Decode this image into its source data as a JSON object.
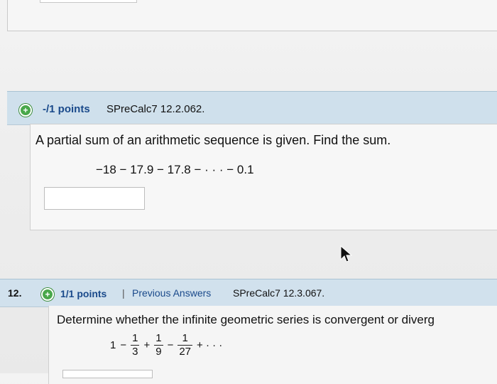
{
  "q11": {
    "points": "-/1 points",
    "ref": "SPreCalc7 12.2.062.",
    "question": "A partial sum of an arithmetic sequence is given. Find the sum.",
    "sequence": "−18 − 17.9 − 17.8 − · · · − 0.1",
    "answer_value": ""
  },
  "q12": {
    "number": "12.",
    "points": "1/1 points",
    "separator": "|",
    "previous_answers": "Previous Answers",
    "ref": "SPreCalc7 12.3.067.",
    "question": "Determine whether the infinite geometric series is convergent or diverg",
    "series": {
      "first": "1",
      "op1": "−",
      "f1": {
        "num": "1",
        "den": "3"
      },
      "op2": "+",
      "f2": {
        "num": "1",
        "den": "9"
      },
      "op3": "−",
      "f3": {
        "num": "1",
        "den": "27"
      },
      "tail": "+ · · ·"
    }
  },
  "colors": {
    "header_bg": "#cfe0ec",
    "points_text": "#1a4a8b",
    "plus_icon": "#49a84a"
  },
  "icons": {
    "expand": "plus-circle-icon",
    "cursor": "mouse-pointer-icon"
  }
}
